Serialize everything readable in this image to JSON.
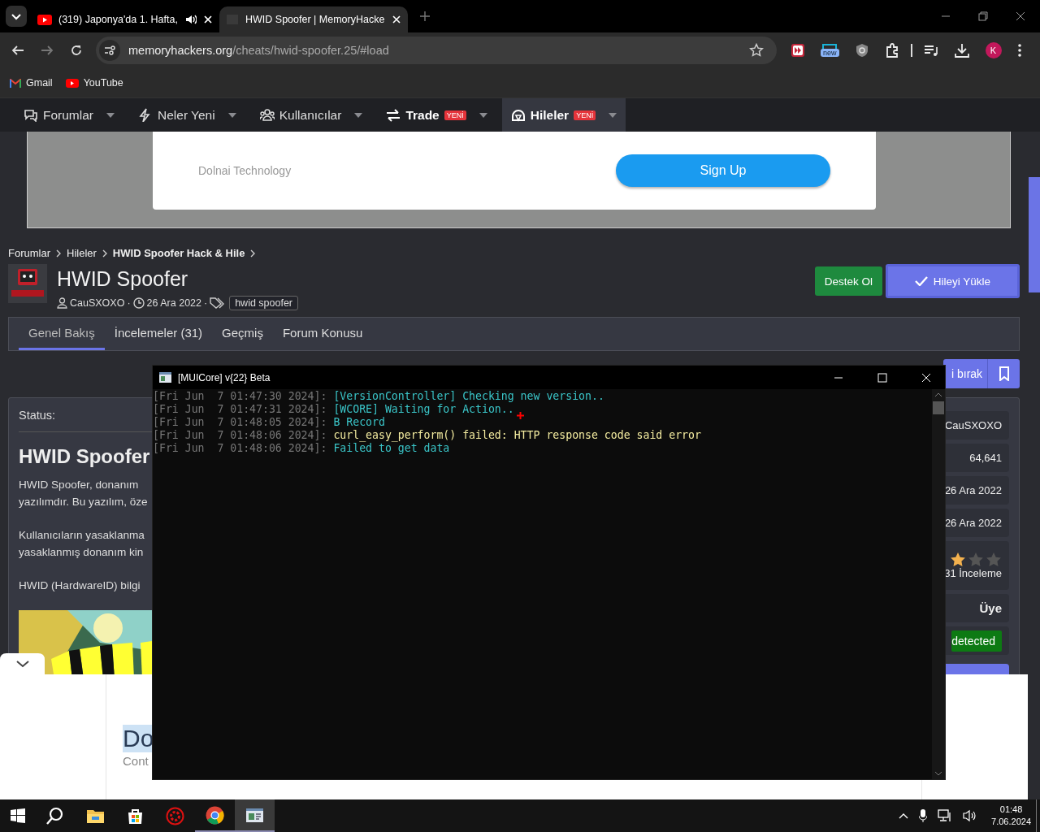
{
  "browser": {
    "tabs": [
      {
        "title": "(319) Japonya'da 1. Hafta,",
        "selected": false,
        "audio": true
      },
      {
        "title": "HWID Spoofer | MemoryHacke",
        "selected": true,
        "audio": false
      }
    ],
    "url": {
      "host": "memoryhackers.org",
      "path": "/cheats/hwid-spoofer.25/#load"
    },
    "extension_badge": "new",
    "profile_initial": "K",
    "bookmarks": [
      {
        "label": "Gmail",
        "kind": "mail"
      },
      {
        "label": "YouTube",
        "kind": "video"
      }
    ]
  },
  "site": {
    "nav": [
      {
        "label": "Forumlar",
        "kind": "chat",
        "bold": false,
        "selected": false
      },
      {
        "label": "Neler Yeni",
        "kind": "bolt",
        "bold": false,
        "selected": false
      },
      {
        "label": "Kullanıcılar",
        "kind": "users",
        "bold": false,
        "selected": false
      },
      {
        "label": "Trade",
        "kind": "swap",
        "bold": true,
        "selected": false,
        "badge": "YENİ"
      },
      {
        "label": "Hileler",
        "kind": "helmet",
        "bold": true,
        "selected": true,
        "badge": "YENİ"
      }
    ],
    "ad": {
      "company": "Dolnai Technology",
      "button": "Sign Up"
    },
    "breadcrumb": [
      {
        "label": "Forumlar",
        "current": false
      },
      {
        "label": "Hileler",
        "current": false
      },
      {
        "label": "HWID Spoofer Hack & Hile",
        "current": true
      }
    ],
    "title": "HWID Spoofer",
    "author": "CauSXOXO",
    "separators": [
      "·",
      "·"
    ],
    "date": "26 Ara 2022",
    "tag": "hwid spoofer",
    "buttons": [
      {
        "label": "Destek Ol",
        "kind": "support"
      },
      {
        "label": "Hileyi Yükle",
        "kind": "primary"
      }
    ],
    "tabs": [
      {
        "label": "Genel Bakış",
        "selected": true
      },
      {
        "label": "İncelemeler (31)",
        "selected": false
      },
      {
        "label": "Geçmiş",
        "selected": false
      },
      {
        "label": "Forum Konusu",
        "selected": false
      }
    ],
    "content": {
      "status_label": "Status:",
      "heading": "HWID Spoofer",
      "paragraphs": [
        [
          "HWID Spoofer, donanım",
          "yazılımdır. Bu yazılım, öze"
        ],
        [
          "Kullanıcıların yasaklanma",
          "yasaklanmış donanım kin"
        ],
        [
          "HWID (HardwareID) bilgi"
        ]
      ],
      "image": {
        "kind": "picture"
      }
    },
    "sidebar": {
      "action": "i bırak",
      "info": [
        "CauSXOXO",
        "64,641",
        "26 Ara 2022",
        "26 Ara 2022"
      ],
      "stars": 1,
      "reviews": "31 İnceleme",
      "role": "Üye",
      "status": "detected"
    },
    "bottom_ad": {
      "title": "Do",
      "subtitle": "Cont"
    }
  },
  "console": {
    "title": "[MUICore] v{22} Beta",
    "lines": [
      {
        "time": "[Fri Jun  7 01:47:30 2024]:",
        "message": "[VersionController] Checking new version..",
        "kind": "info"
      },
      {
        "time": "[Fri Jun  7 01:47:31 2024]:",
        "message": "[WCORE] Waiting for Action..",
        "kind": "info"
      },
      {
        "time": "[Fri Jun  7 01:48:05 2024]:",
        "message": "B Record",
        "kind": "info"
      },
      {
        "time": "[Fri Jun  7 01:48:06 2024]:",
        "message": "curl_easy_perform() failed: HTTP response code said error",
        "kind": "warning"
      },
      {
        "time": "[Fri Jun  7 01:48:06 2024]:",
        "message": "Failed to get data",
        "kind": "info"
      }
    ]
  },
  "taskbar": {
    "apps": [
      {
        "kind": "search",
        "selected": false
      },
      {
        "kind": "folder",
        "selected": false
      },
      {
        "kind": "store",
        "selected": false
      },
      {
        "kind": "gear",
        "selected": false
      },
      {
        "kind": "chrome",
        "selected": false,
        "running": true
      },
      {
        "kind": "console",
        "selected": true,
        "running": true
      }
    ],
    "time": "01:48",
    "date": "7.06.2024"
  }
}
